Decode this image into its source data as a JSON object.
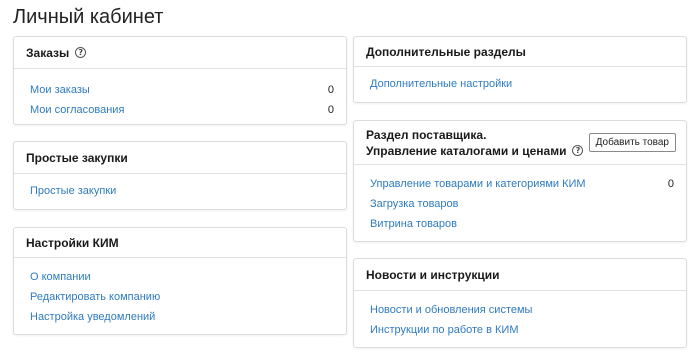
{
  "page": {
    "title": "Личный кабинет"
  },
  "orders": {
    "title": "Заказы",
    "items": [
      {
        "label": "Мои заказы",
        "count": "0"
      },
      {
        "label": "Мои согласования",
        "count": "0"
      }
    ]
  },
  "simple_purchases": {
    "title": "Простые закупки",
    "items": [
      {
        "label": "Простые закупки"
      }
    ]
  },
  "kim_settings": {
    "title": "Настройки КИМ",
    "items": [
      {
        "label": "О компании"
      },
      {
        "label": "Редактировать компанию"
      },
      {
        "label": "Настройка уведомлений"
      }
    ]
  },
  "extra_sections": {
    "title": "Дополнительные разделы",
    "items": [
      {
        "label": "Дополнительные настройки"
      }
    ]
  },
  "supplier": {
    "title_line1": "Раздел поставщика.",
    "title_line2": "Управление каталогами и ценами",
    "add_button": "Добавить товар",
    "items": [
      {
        "label": "Управление товарами и категориями КИМ",
        "count": "0"
      },
      {
        "label": "Загрузка товаров"
      },
      {
        "label": "Витрина товаров"
      }
    ]
  },
  "news": {
    "title": "Новости и инструкции",
    "items": [
      {
        "label": "Новости и обновления системы"
      },
      {
        "label": "Инструкции по работе в КИМ"
      }
    ]
  },
  "icons": {
    "help": "question-circle-icon"
  },
  "colors": {
    "link": "#2f7bbf",
    "border": "#dcdcdc"
  }
}
